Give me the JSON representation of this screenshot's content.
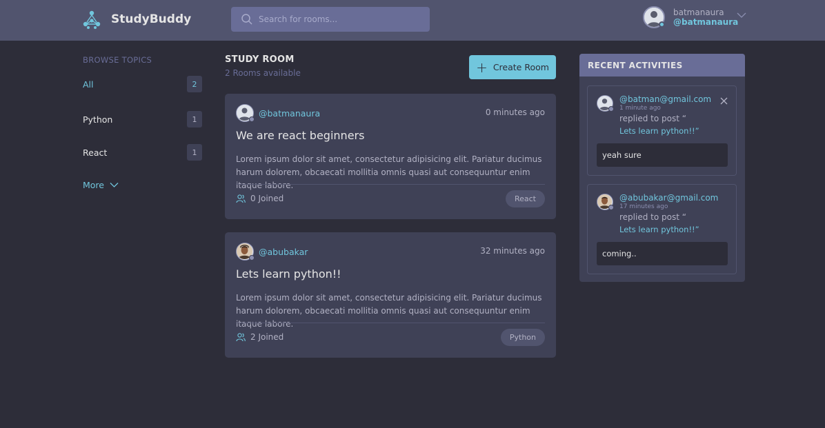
{
  "header": {
    "brand": "StudyBuddy",
    "search_placeholder": "Search for rooms...",
    "user": {
      "name": "batmanaura",
      "handle": "@batmanaura"
    }
  },
  "sidebar": {
    "title": "BROWSE TOPICS",
    "topics": [
      {
        "label": "All",
        "count": "2",
        "active": true
      },
      {
        "label": "Python",
        "count": "1",
        "active": false
      },
      {
        "label": "React",
        "count": "1",
        "active": false
      }
    ],
    "more_label": "More"
  },
  "main": {
    "title": "STUDY ROOM",
    "subtitle": "2 Rooms available",
    "create_label": "Create Room",
    "rooms": [
      {
        "host": "@batmanaura",
        "time": "0 minutes ago",
        "name": "We are react beginners",
        "description": "Lorem ipsum dolor sit amet, consectetur adipisicing elit. Pariatur ducimus harum dolorem, obcaecati mollitia omnis quasi aut consequuntur enim itaque labore.",
        "joined": "0 Joined",
        "topic": "React"
      },
      {
        "host": "@abubakar",
        "time": "32 minutes ago",
        "name": "Lets learn python!!",
        "description": "Lorem ipsum dolor sit amet, consectetur adipisicing elit. Pariatur ducimus harum dolorem, obcaecati mollitia omnis quasi aut consequuntur enim itaque labore.",
        "joined": "2 Joined",
        "topic": "Python"
      }
    ]
  },
  "activities": {
    "title": "RECENT ACTIVITIES",
    "items": [
      {
        "email": "@batman@gmail.com",
        "time": "1 minute ago",
        "action": "replied to post “",
        "post": "Lets learn python!!”",
        "reply": "yeah sure"
      },
      {
        "email": "@abubakar@gmail.com",
        "time": "17 minutes ago",
        "action": "replied to post “",
        "post": "Lets learn python!!”",
        "reply": "coming.."
      }
    ]
  },
  "colors": {
    "accent": "#71c6dd",
    "background": "#2d2d39",
    "header": "#51546e",
    "card": "#3f4156",
    "muted": "#696d97"
  }
}
